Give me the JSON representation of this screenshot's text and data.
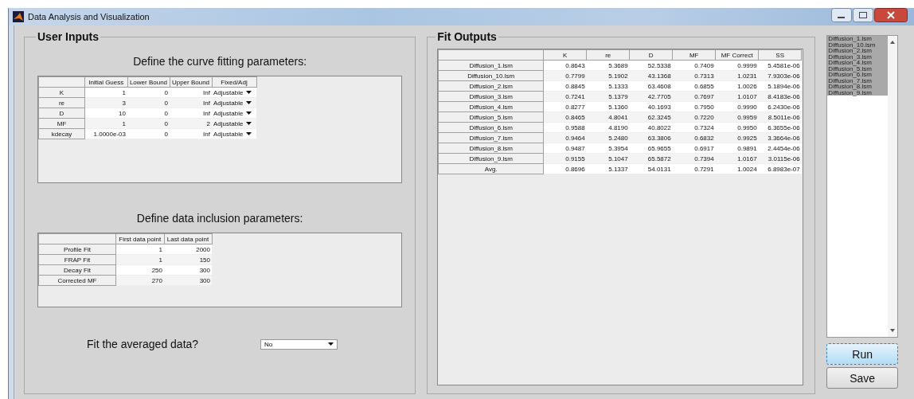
{
  "window": {
    "title": "Data Analysis and Visualization"
  },
  "user_inputs": {
    "title": "User Inputs",
    "fitting_heading": "Define the curve fitting parameters:",
    "fitting_table": {
      "columns": [
        "Initial Guess",
        "Lower Bound",
        "Upper Bound",
        "Fixed/Adj"
      ],
      "rows": [
        {
          "label": "K",
          "cells": [
            "1",
            "0",
            "Inf"
          ],
          "fixed_adj": "Adjustable"
        },
        {
          "label": "re",
          "cells": [
            "3",
            "0",
            "Inf"
          ],
          "fixed_adj": "Adjustable"
        },
        {
          "label": "D",
          "cells": [
            "10",
            "0",
            "Inf"
          ],
          "fixed_adj": "Adjustable"
        },
        {
          "label": "MF",
          "cells": [
            "1",
            "0",
            "2"
          ],
          "fixed_adj": "Adjustable"
        },
        {
          "label": "kdecay",
          "cells": [
            "1.0000e-03",
            "0",
            "Inf"
          ],
          "fixed_adj": "Adjustable"
        }
      ]
    },
    "inclusion_heading": "Define data inclusion parameters:",
    "inclusion_table": {
      "columns": [
        "First data point",
        "Last data point"
      ],
      "rows": [
        {
          "label": "Profile Fit",
          "cells": [
            "1",
            "2000"
          ]
        },
        {
          "label": "FRAP Fit",
          "cells": [
            "1",
            "150"
          ]
        },
        {
          "label": "Decay Fit",
          "cells": [
            "250",
            "300"
          ]
        },
        {
          "label": "Corrected MF",
          "cells": [
            "270",
            "300"
          ]
        }
      ]
    },
    "averaged_label": "Fit the averaged data?",
    "averaged_dropdown": {
      "value": "No"
    }
  },
  "fit_outputs": {
    "title": "Fit Outputs",
    "table": {
      "columns": [
        "K",
        "re",
        "D",
        "MF",
        "MF Correct",
        "SS"
      ],
      "rows": [
        {
          "label": "Diffusion_1.lsm",
          "cells": [
            "0.8643",
            "5.3689",
            "52.5338",
            "0.7409",
            "0.9999",
            "5.4581e-06"
          ]
        },
        {
          "label": "Diffusion_10.lsm",
          "cells": [
            "0.7799",
            "5.1902",
            "43.1368",
            "0.7313",
            "1.0231",
            "7.9303e-06"
          ]
        },
        {
          "label": "Diffusion_2.lsm",
          "cells": [
            "0.8845",
            "5.1333",
            "63.4608",
            "0.6855",
            "1.0026",
            "5.1894e-06"
          ]
        },
        {
          "label": "Diffusion_3.lsm",
          "cells": [
            "0.7241",
            "5.1379",
            "42.7705",
            "0.7697",
            "1.0107",
            "8.4183e-06"
          ]
        },
        {
          "label": "Diffusion_4.lsm",
          "cells": [
            "0.8277",
            "5.1360",
            "40.1693",
            "0.7950",
            "0.9990",
            "6.2430e-06"
          ]
        },
        {
          "label": "Diffusion_5.lsm",
          "cells": [
            "0.8465",
            "4.8041",
            "62.3245",
            "0.7220",
            "0.9959",
            "8.5011e-06"
          ]
        },
        {
          "label": "Diffusion_6.lsm",
          "cells": [
            "0.9588",
            "4.8190",
            "40.8022",
            "0.7324",
            "0.9950",
            "6.3655e-06"
          ]
        },
        {
          "label": "Diffusion_7.lsm",
          "cells": [
            "0.9464",
            "5.2480",
            "63.3806",
            "0.6832",
            "0.9925",
            "3.3664e-06"
          ]
        },
        {
          "label": "Diffusion_8.lsm",
          "cells": [
            "0.9487",
            "5.3954",
            "65.9655",
            "0.6917",
            "0.9891",
            "2.4454e-06"
          ]
        },
        {
          "label": "Diffusion_9.lsm",
          "cells": [
            "0.9155",
            "5.1047",
            "65.5872",
            "0.7394",
            "1.0167",
            "3.0115e-06"
          ]
        },
        {
          "label": "Avg.",
          "cells": [
            "0.8696",
            "5.1337",
            "54.0131",
            "0.7291",
            "1.0024",
            "6.8983e-07"
          ]
        }
      ]
    }
  },
  "file_list": {
    "items": [
      {
        "label": "Diffusion_1.lsm",
        "selected": true
      },
      {
        "label": "Diffusion_10.lsm",
        "selected": true
      },
      {
        "label": "Diffusion_2.lsm",
        "selected": true
      },
      {
        "label": "Diffusion_3.lsm",
        "selected": true
      },
      {
        "label": "Diffusion_4.lsm",
        "selected": true
      },
      {
        "label": "Diffusion_5.lsm",
        "selected": true
      },
      {
        "label": "Diffusion_6.lsm",
        "selected": true
      },
      {
        "label": "Diffusion_7.lsm",
        "selected": true
      },
      {
        "label": "Diffusion_8.lsm",
        "selected": true
      },
      {
        "label": "Diffusion_9.lsm",
        "selected": true
      }
    ]
  },
  "buttons": [
    {
      "label": "Run",
      "focused": true
    },
    {
      "label": "Save",
      "focused": false
    }
  ]
}
